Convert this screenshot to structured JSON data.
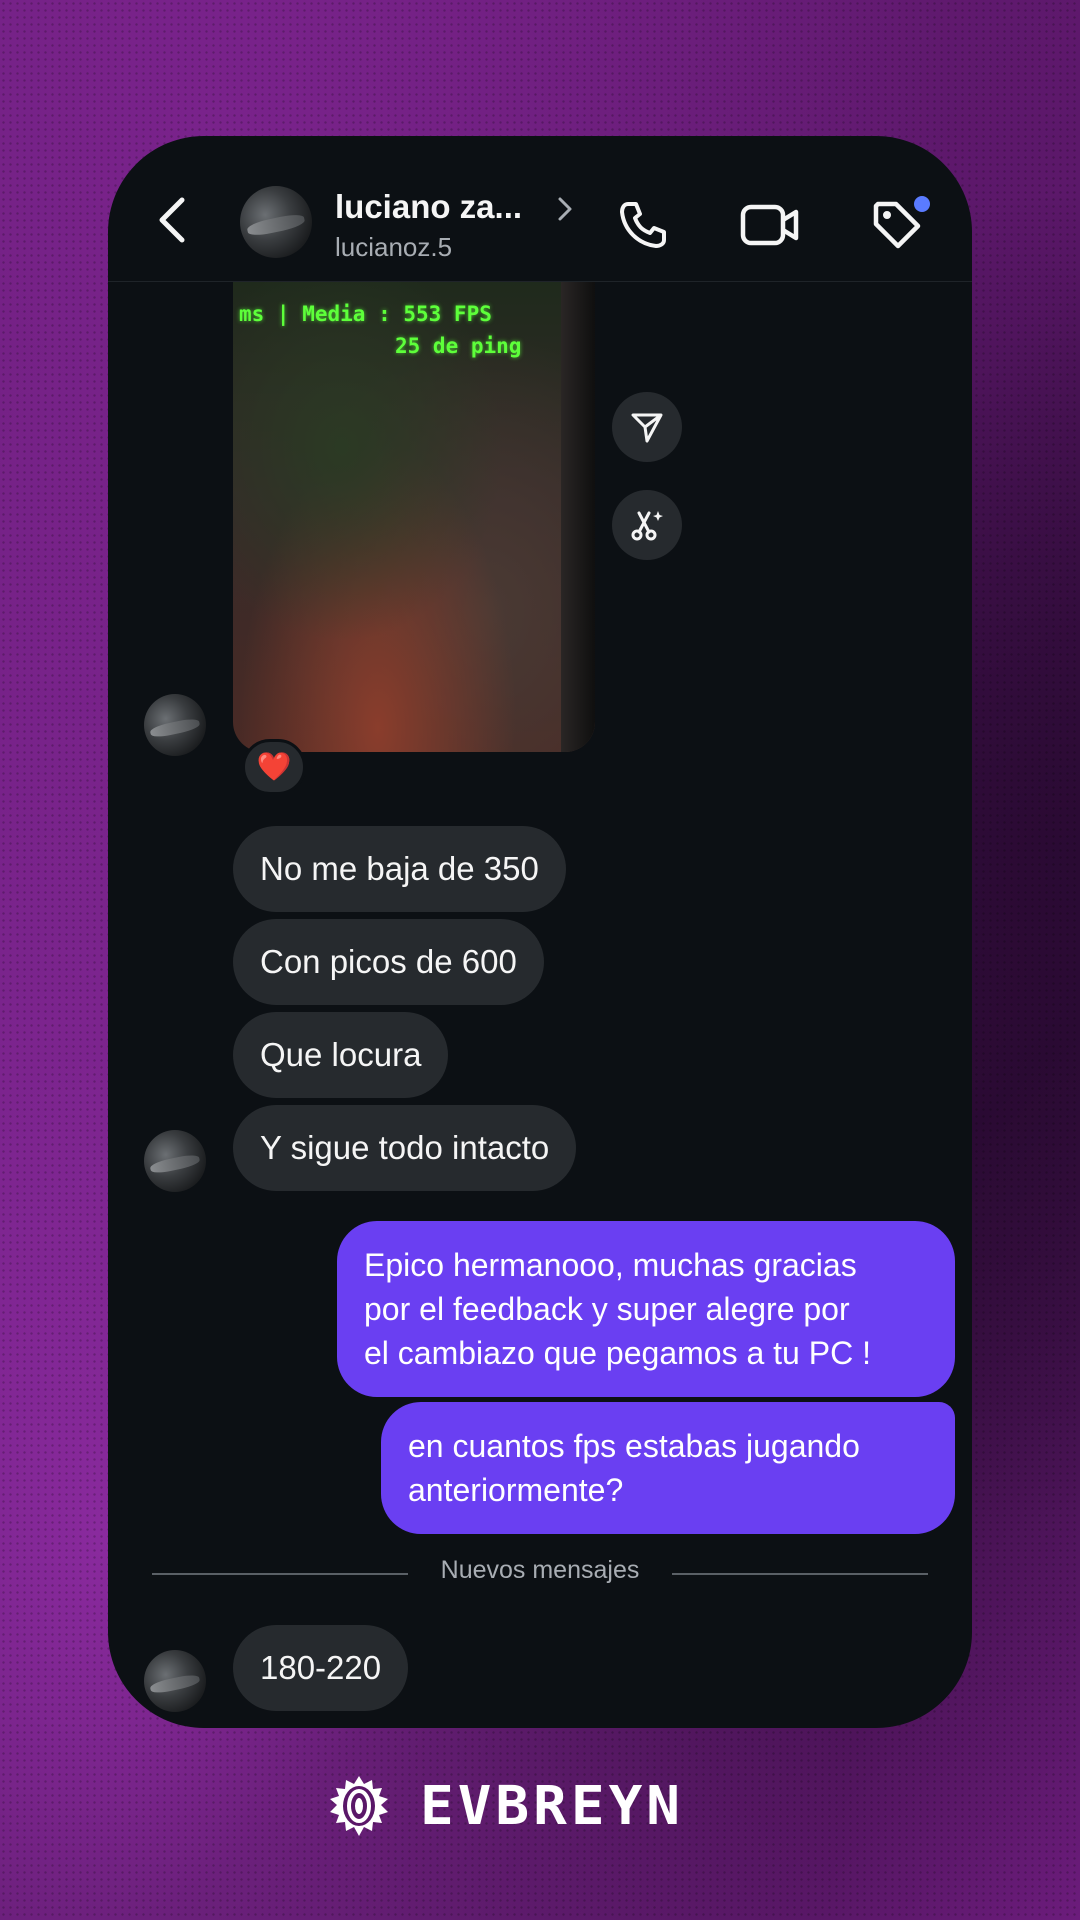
{
  "header": {
    "title": "luciano za...",
    "username": "lucianoz.5"
  },
  "media_message": {
    "overlay_line1": "ms | Media :  553 FPS",
    "overlay_line2": "25 de ping",
    "reaction": "❤️"
  },
  "incoming_messages": [
    "No me baja de 350",
    "Con picos de 600",
    "Que locura",
    "Y sigue todo intacto"
  ],
  "outgoing_messages": [
    "Epico hermanooo, muchas gracias\npor el feedback y super alegre por\nel cambiazo que pegamos a tu PC !",
    "en cuantos fps estabas jugando\nanteriormente?"
  ],
  "divider_label": "Nuevos mensajes",
  "last_incoming": "180-220",
  "brand": {
    "name": "EVBREYN"
  },
  "icons": [
    "back-icon",
    "chevron-right-icon",
    "phone-icon",
    "video-icon",
    "tag-icon",
    "send-icon",
    "scissors-sparkle-icon",
    "heart-icon"
  ],
  "colors": {
    "background": "#6e1f7e",
    "chat_background": "#0c1014",
    "incoming_bubble": "#262a2e",
    "outgoing_bubble": "#6a3ff2",
    "notification_dot": "#5a7bff"
  }
}
